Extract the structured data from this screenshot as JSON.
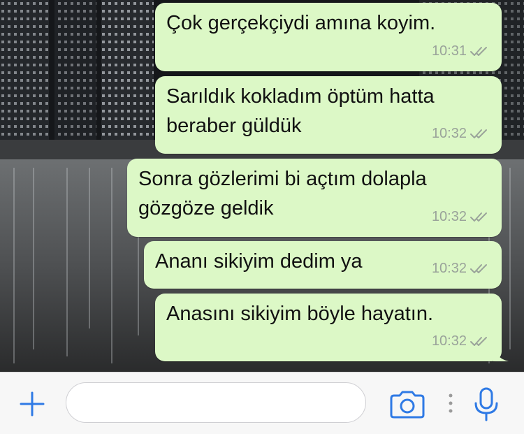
{
  "messages": [
    {
      "text": "Çok gerçekçiydi amına koyim.",
      "time": "10:31",
      "status": "read-ticks-icon"
    },
    {
      "text": "Sarıldık kokladım öptüm hatta\nberaber güldük",
      "time": "10:32",
      "status": "read-ticks-icon"
    },
    {
      "text": "Sonra gözlerimi bi açtım dolapla\ngözgöze geldik",
      "time": "10:32",
      "status": "read-ticks-icon"
    },
    {
      "text": "Ananı sikiyim dedim ya",
      "time": "10:32",
      "status": "read-ticks-icon"
    },
    {
      "text": "Anasını sikiyim böyle hayatın.",
      "time": "10:32",
      "status": "read-ticks-icon"
    }
  ],
  "input_bar": {
    "plus_icon": "plus-icon",
    "message_placeholder": "",
    "camera_icon": "camera-icon",
    "mic_icon": "microphone-icon"
  },
  "colors": {
    "bubble": "#dcf8c6",
    "accent": "#2f7ae5",
    "meta": "#9aa39a"
  }
}
